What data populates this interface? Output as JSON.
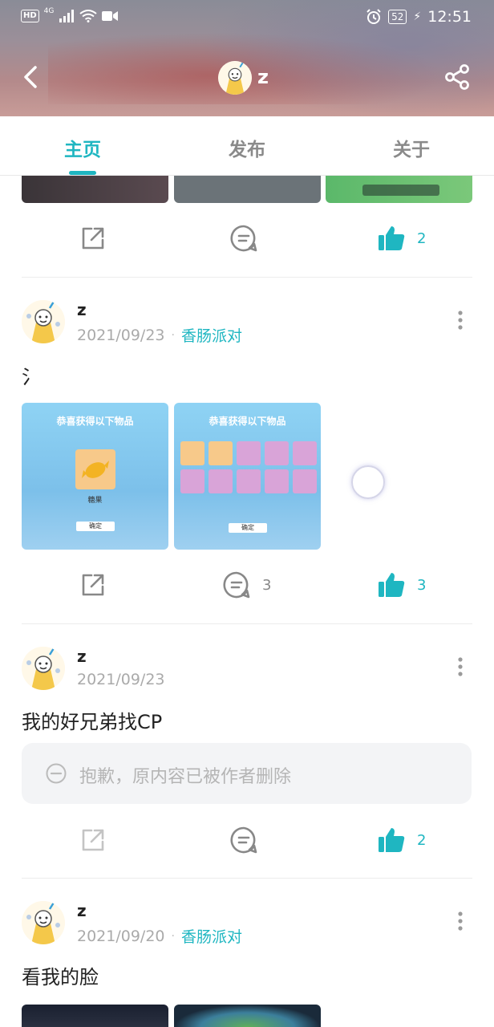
{
  "status_bar": {
    "hd": "HD",
    "network": "4G",
    "battery": "52",
    "time": "12:51"
  },
  "nav": {
    "username": "z"
  },
  "tabs": [
    {
      "label": "主页",
      "active": true
    },
    {
      "label": "发布",
      "active": false
    },
    {
      "label": "关于",
      "active": false
    }
  ],
  "posts": [
    {
      "like_count": "2",
      "comment_count": ""
    },
    {
      "author": "z",
      "date": "2021/09/23",
      "tag": "香肠派对",
      "text": "氵",
      "thumb_titles": [
        "恭喜获得以下物品",
        "恭喜获得以下物品"
      ],
      "thumb_item": "糖果",
      "thumb_confirm": "确定",
      "comment_count": "3",
      "like_count": "3"
    },
    {
      "author": "z",
      "date": "2021/09/23",
      "text": "我的好兄弟找CP",
      "deleted_notice": "抱歉，原内容已被作者删除",
      "like_count": "2"
    },
    {
      "author": "z",
      "date": "2021/09/20",
      "tag": "香肠派对",
      "text": "看我的脸"
    }
  ],
  "colors": {
    "accent": "#1fb6c1",
    "muted": "#8a8a8a",
    "divider": "#ececec"
  },
  "icons": [
    "back-icon",
    "share-icon",
    "forward-icon",
    "comment-icon",
    "thumbs-up-icon",
    "more-icon",
    "deleted-icon"
  ]
}
